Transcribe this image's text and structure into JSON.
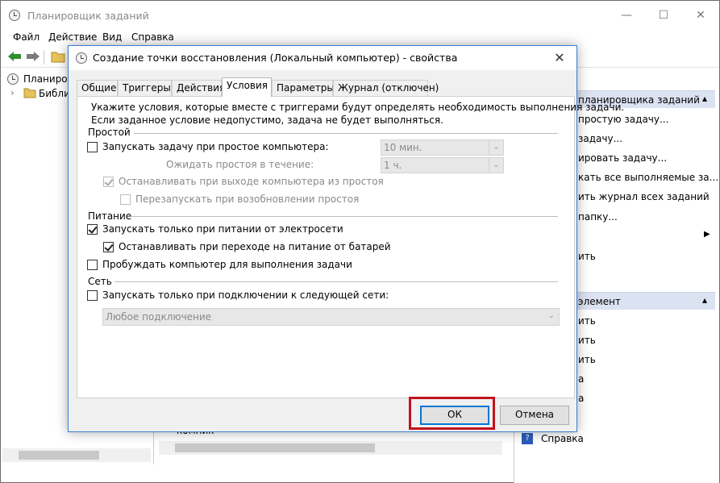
{
  "main_window": {
    "title": "Планировщик заданий",
    "menu": [
      "Файл",
      "Действие",
      "Вид",
      "Справка"
    ],
    "caption_buttons": {
      "minimize": "—",
      "maximize": "☐",
      "close": "✕"
    }
  },
  "tree": {
    "root": "Планиро",
    "child": "Библи"
  },
  "right_pane": {
    "section1_header": "планировщика заданий",
    "items1": [
      "простую задачу...",
      "задачу...",
      "ировать задачу...",
      "кать все выполняемые за...",
      "ить журнал всех заданий",
      "папку...",
      "",
      "ить"
    ],
    "section2_header": "элемент",
    "items2": [
      "ить",
      "ить",
      "ить",
      "а",
      "а"
    ],
    "help_label": "Справка"
  },
  "bottom": {
    "partial_text": "компик"
  },
  "dialog": {
    "title": "Создание точки восстановления (Локальный компьютер) - свойства",
    "close_glyph": "✕",
    "tabs": [
      "Общие",
      "Триггеры",
      "Действия",
      "Условия",
      "Параметры",
      "Журнал (отключен)"
    ],
    "active_tab": "Условия",
    "description_line1": "Укажите условия, которые вместе с триггерами будут определять необходимость выполнения задачи.",
    "description_line2": "Если заданное условие недопустимо, задача не будет выполняться.",
    "idle_group": "Простой",
    "idle_start": {
      "label": "Запускать задачу при простое компьютера:",
      "checked": false,
      "value": "10 мин."
    },
    "idle_wait": {
      "label": "Ожидать простоя в течение:",
      "value": "1 ч."
    },
    "idle_stop": {
      "label": "Останавливать при выходе компьютера из простоя",
      "checked": true
    },
    "idle_restart": {
      "label": "Перезапускать при возобновлении простоя",
      "checked": false
    },
    "power_group": "Питание",
    "power_ac": {
      "label": "Запускать только при питании от электросети",
      "checked": true
    },
    "power_battery": {
      "label": "Останавливать при переходе на питание от батарей",
      "checked": true
    },
    "power_wake": {
      "label": "Пробуждать компьютер для выполнения задачи",
      "checked": false
    },
    "network_group": "Сеть",
    "network_start": {
      "label": "Запускать только при подключении к следующей сети:",
      "checked": false
    },
    "network_value": "Любое подключение",
    "ok_label": "ОК",
    "cancel_label": "Отмена"
  },
  "colors": {
    "accent": "#0078d7",
    "highlight_frame": "#c0141c",
    "section_header": "#dbe2f1"
  },
  "icons": [
    "clock-icon",
    "back-arrow-icon",
    "forward-arrow-icon",
    "folder-icon",
    "help-icon",
    "chevron-down-icon",
    "chevron-right-icon"
  ]
}
